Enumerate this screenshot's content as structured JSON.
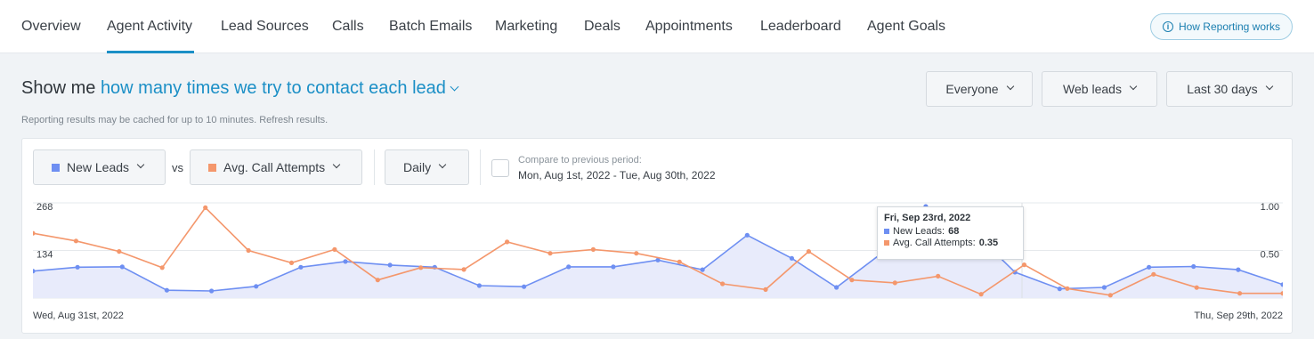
{
  "nav": {
    "tabs": [
      {
        "label": "Overview"
      },
      {
        "label": "Agent Activity"
      },
      {
        "label": "Lead Sources"
      },
      {
        "label": "Calls"
      },
      {
        "label": "Batch Emails"
      },
      {
        "label": "Marketing"
      },
      {
        "label": "Deals"
      },
      {
        "label": "Appointments"
      },
      {
        "label": "Leaderboard"
      },
      {
        "label": "Agent Goals"
      }
    ],
    "active_tab": "Agent Activity",
    "help_button": "How Reporting works"
  },
  "headline": {
    "prefix": "Show me",
    "metric": "how many times we try to contact each lead"
  },
  "filters": {
    "agent": "Everyone",
    "source": "Web leads",
    "range": "Last 30 days"
  },
  "cache_note": "Reporting results may be cached for up to 10 minutes.",
  "refresh_link": "Refresh results.",
  "controls": {
    "primary_metric": "New Leads",
    "vs_label": "vs",
    "secondary_metric": "Avg. Call Attempts",
    "interval": "Daily",
    "compare_label": "Compare to previous period:",
    "compare_range": "Mon, Aug 1st, 2022 - Tue, Aug 30th, 2022"
  },
  "colors": {
    "accent": "#1b8fc6",
    "new_leads": "#6e8ff2",
    "avg_call_attempts": "#f4976c",
    "area_fill": "#e8ebfb"
  },
  "chart_data": {
    "type": "line",
    "x_start_label": "Wed, Aug 31st, 2022",
    "x_end_label": "Thu, Sep 29th, 2022",
    "left_axis": {
      "ticks": [
        134,
        268
      ],
      "ylim": [
        0,
        268
      ]
    },
    "right_axis": {
      "ticks": [
        0.5,
        1.0
      ],
      "tick_labels": [
        "0.50",
        "1.00"
      ],
      "ylim": [
        0,
        1.0
      ]
    },
    "series": [
      {
        "name": "New Leads",
        "axis": "left",
        "style": "area",
        "values": [
          76,
          87,
          88,
          22,
          20,
          33,
          87,
          103,
          93,
          87,
          35,
          32,
          88,
          88,
          107,
          80,
          177,
          112,
          30,
          125,
          258,
          195,
          73,
          26,
          30,
          87,
          89,
          80,
          38
        ]
      },
      {
        "name": "Avg. Call Attempts",
        "axis": "right",
        "style": "line",
        "values": [
          0.68,
          0.6,
          0.49,
          0.32,
          0.95,
          0.5,
          0.37,
          0.51,
          0.19,
          0.32,
          0.3,
          0.59,
          0.47,
          0.51,
          0.47,
          0.38,
          0.15,
          0.09,
          0.49,
          0.19,
          0.16,
          0.23,
          0.04,
          0.35,
          0.1,
          0.03,
          0.25,
          0.11,
          0.05,
          0.05
        ]
      }
    ],
    "tooltip": {
      "date": "Fri, Sep 23rd, 2022",
      "new_leads_label": "New Leads:",
      "new_leads_value": "68",
      "avg_label": "Avg. Call Attempts:",
      "avg_value": "0.35"
    }
  }
}
